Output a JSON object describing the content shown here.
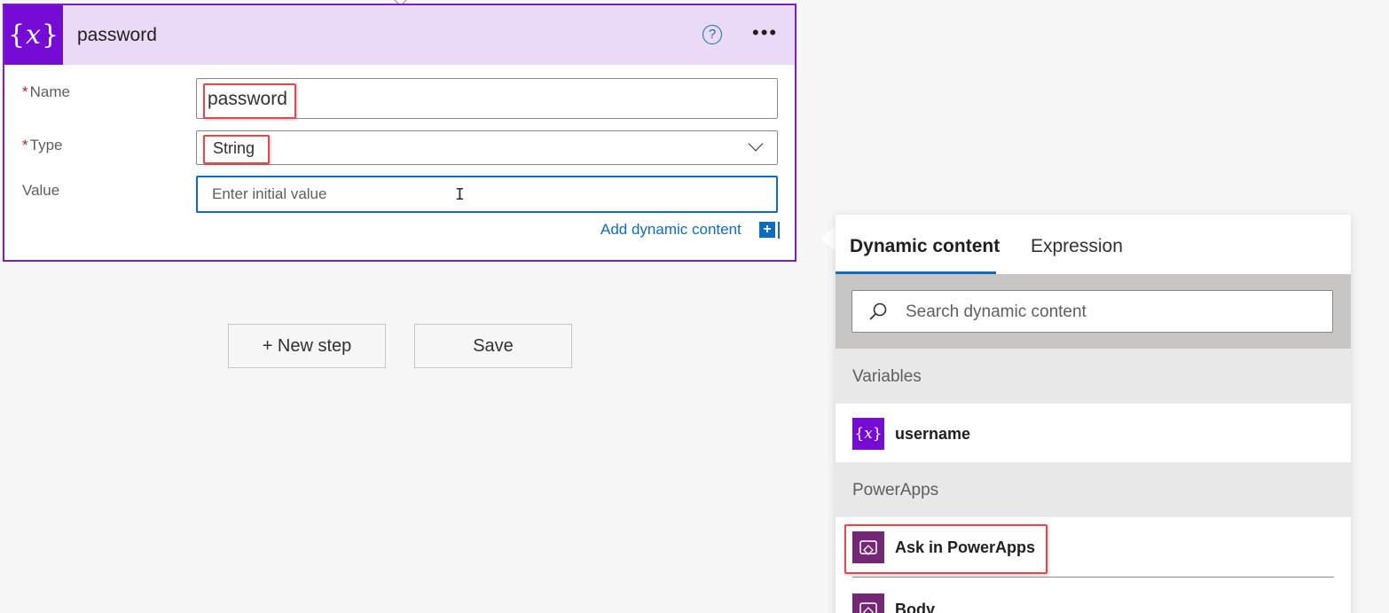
{
  "card": {
    "title": "password",
    "icon": "variable-icon",
    "accent_color": "#770bd6",
    "header_color": "#ead9f7",
    "help_symbol": "?",
    "more_symbol": "•••",
    "fields": {
      "name": {
        "required_mark": "*",
        "label": "Name",
        "value": "password"
      },
      "type": {
        "required_mark": "*",
        "label": "Type",
        "value": "String"
      },
      "value": {
        "label": "Value",
        "placeholder": "Enter initial value"
      }
    },
    "add_dynamic_content": "Add dynamic content",
    "add_symbol": "+"
  },
  "actions": {
    "new_step": "+ New step",
    "save": "Save"
  },
  "dynamic_panel": {
    "tabs": [
      "Dynamic content",
      "Expression"
    ],
    "active_tab": "Dynamic content",
    "search_placeholder": "Search dynamic content",
    "sections": [
      {
        "title": "Variables",
        "items": [
          {
            "label": "username",
            "icon": "variable-icon"
          }
        ]
      },
      {
        "title": "PowerApps",
        "items": [
          {
            "label": "Ask in PowerApps",
            "icon": "powerapps-icon",
            "highlighted": true
          },
          {
            "label": "Body",
            "icon": "powerapps-icon"
          }
        ]
      }
    ]
  },
  "colors": {
    "link_blue": "#0f6cbd",
    "highlight_red": "#e3464b",
    "powerapps_purple": "#742774"
  }
}
